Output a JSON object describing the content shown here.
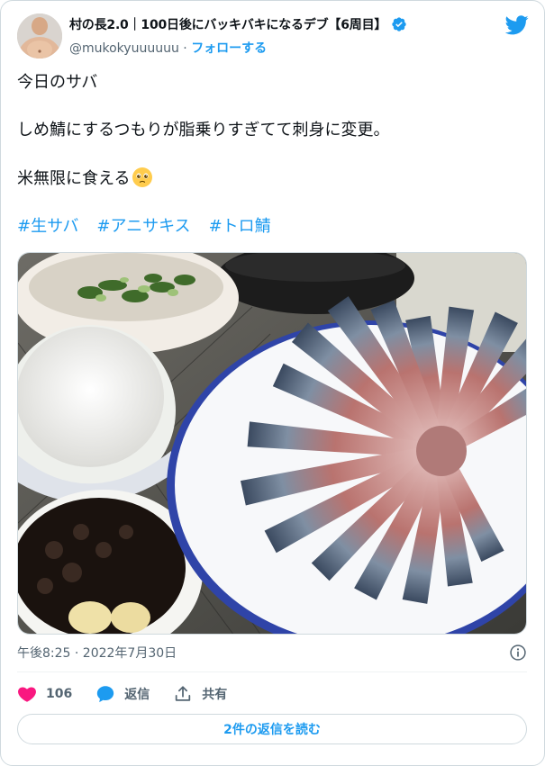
{
  "tweet": {
    "display_name": "村の長2.0｜100日後にバッキバキになるデブ【6周目】",
    "handle": "@mukokyuuuuuu",
    "separator": "·",
    "follow_label": "フォローする",
    "lines": [
      "今日のサバ",
      "しめ鯖にするつもりが脂乗りすぎてて刺身に変更。",
      "米無限に食える"
    ],
    "emoji": "pleading-face-emoji",
    "hashtags": [
      "#生サバ",
      "#アニサキス",
      "#トロ鯖"
    ]
  },
  "meta": {
    "timestamp": "午後8:25 · 2022年7月30日"
  },
  "actions": {
    "like_count": "106",
    "reply_label": "返信",
    "share_label": "共有"
  },
  "read_replies_label": "2件の返信を読む",
  "colors": {
    "accent": "#1d9bf0",
    "like": "#f91880",
    "text": "#0f1419",
    "muted": "#536471"
  }
}
